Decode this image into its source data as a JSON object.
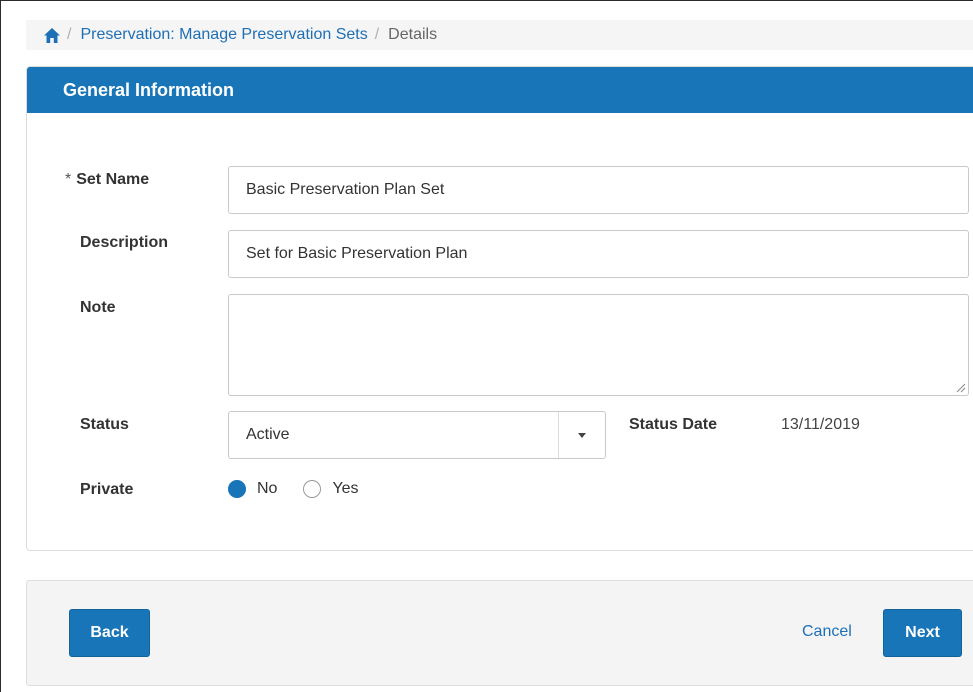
{
  "breadcrumb": {
    "home_icon": "home-icon",
    "separator": "/",
    "link": "Preservation: Manage Preservation Sets",
    "current": "Details"
  },
  "panel": {
    "title": "General Information"
  },
  "form": {
    "required_marker": "*",
    "set_name_label": "Set Name",
    "set_name_value": "Basic Preservation Plan Set",
    "description_label": "Description",
    "description_value": "Set for Basic Preservation Plan",
    "note_label": "Note",
    "note_value": "",
    "status_label": "Status",
    "status_value": "Active",
    "status_date_label": "Status Date",
    "status_date_value": "13/11/2019",
    "private_label": "Private",
    "private_options": [
      {
        "label": "No",
        "selected": true
      },
      {
        "label": "Yes",
        "selected": false
      }
    ]
  },
  "footer": {
    "back_label": "Back",
    "cancel_label": "Cancel",
    "next_label": "Next"
  },
  "colors": {
    "accent": "#1875b7",
    "link": "#1e6fb5"
  }
}
